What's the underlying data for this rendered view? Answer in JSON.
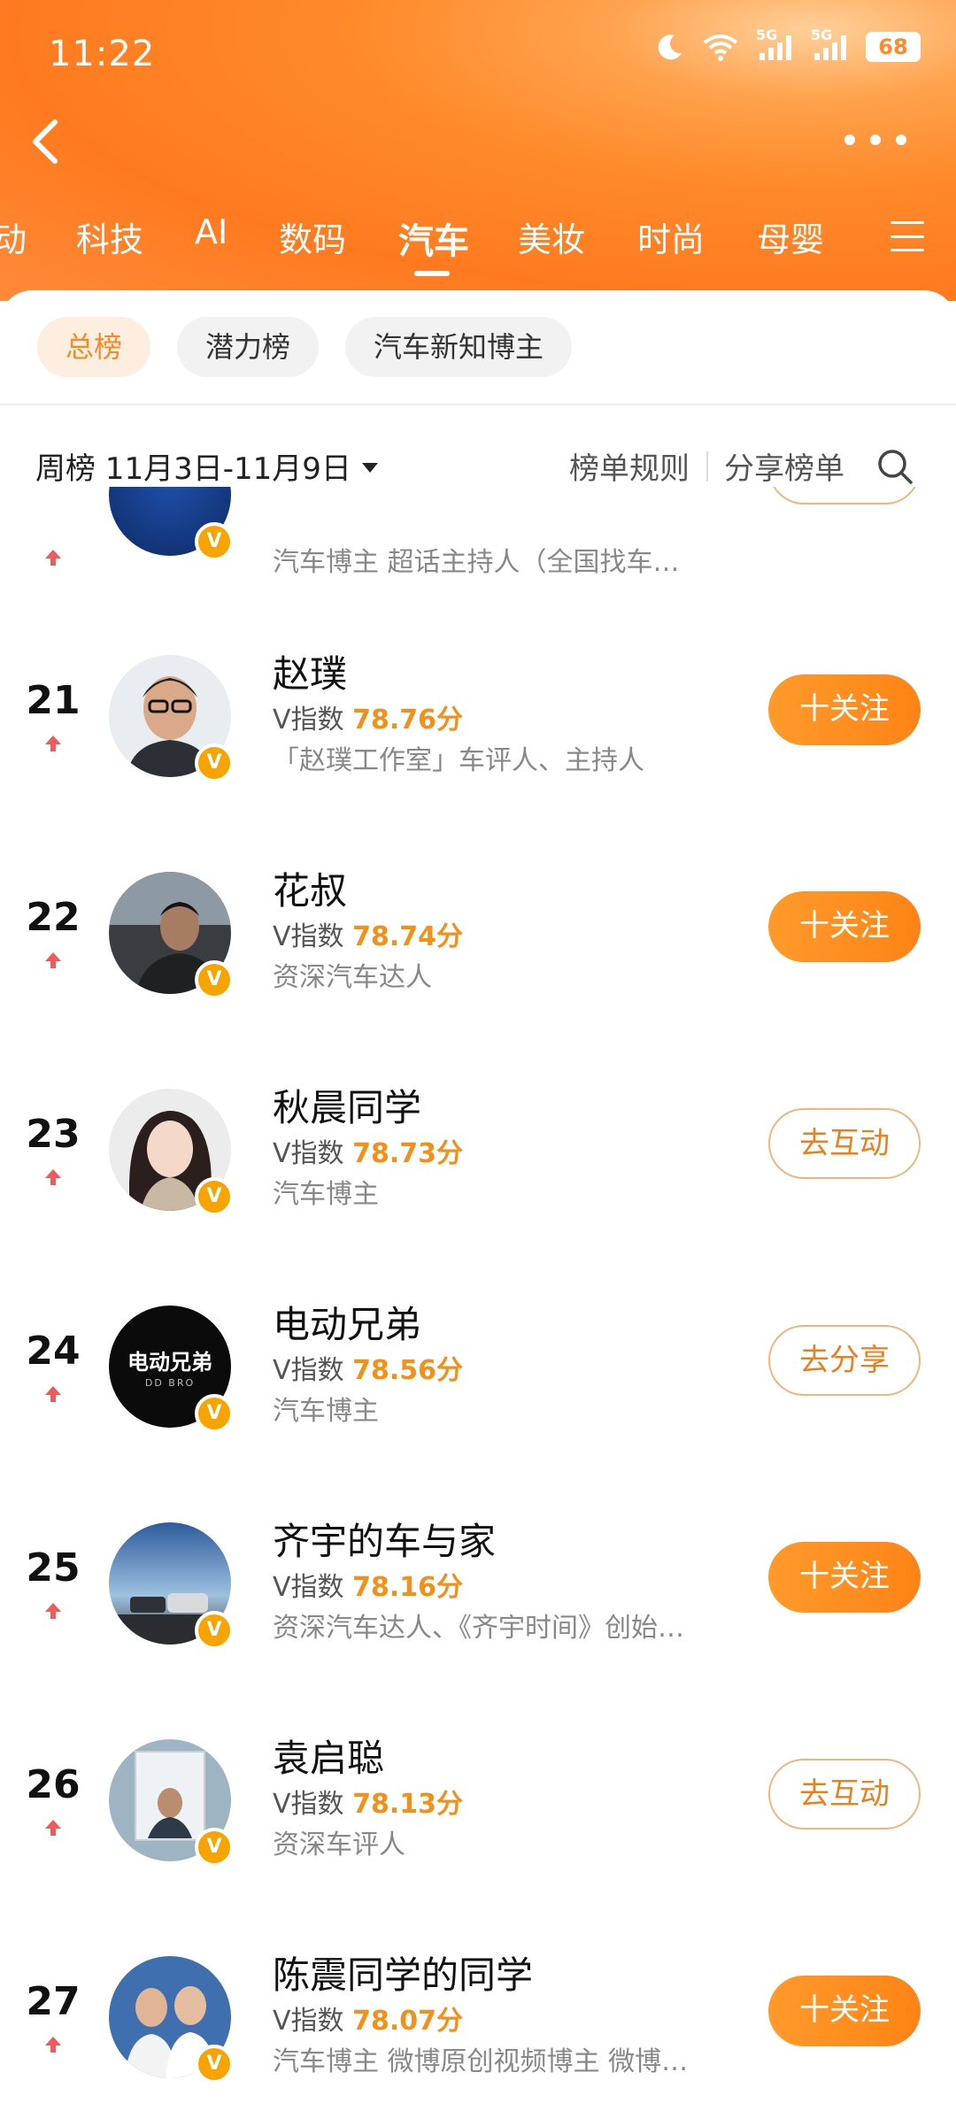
{
  "status": {
    "time": "11:22",
    "battery": "68",
    "signal_1": "5G",
    "signal_2": "5G"
  },
  "tabs": [
    "动",
    "科技",
    "AI",
    "数码",
    "汽车",
    "美妆",
    "时尚",
    "母婴"
  ],
  "active_tab": "汽车",
  "filters": [
    "总榜",
    "潜力榜",
    "汽车新知博主"
  ],
  "subbar": {
    "week": "周榜 11月3日-11月9日",
    "rules": "榜单规则",
    "share": "分享榜单"
  },
  "top_partial": {
    "desc": "汽车博主 超话主持人（全国找车…"
  },
  "rows": [
    {
      "rank": "21",
      "name": "赵璞",
      "index_label": "V指数",
      "score": "78.76分",
      "desc": "「赵璞工作室」车评人、主持人",
      "action": "十关注"
    },
    {
      "rank": "22",
      "name": "花叔",
      "index_label": "V指数",
      "score": "78.74分",
      "desc": "资深汽车达人",
      "action": "十关注"
    },
    {
      "rank": "23",
      "name": "秋晨同学",
      "index_label": "V指数",
      "score": "78.73分",
      "desc": "汽车博主",
      "action": "去互动"
    },
    {
      "rank": "24",
      "name": "电动兄弟",
      "index_label": "V指数",
      "score": "78.56分",
      "desc": "汽车博主",
      "action": "去分享",
      "avatar_text": "电动兄弟",
      "avatar_sub": "DD BRO"
    },
    {
      "rank": "25",
      "name": "齐宇的车与家",
      "index_label": "V指数",
      "score": "78.16分",
      "desc": "资深汽车达人、《齐宇时间》创始…",
      "action": "十关注"
    },
    {
      "rank": "26",
      "name": "袁启聪",
      "index_label": "V指数",
      "score": "78.13分",
      "desc": "资深车评人",
      "action": "去互动"
    },
    {
      "rank": "27",
      "name": "陈震同学的同学",
      "index_label": "V指数",
      "score": "78.07分",
      "desc": "汽车博主 微博原创视频博主 微博…",
      "action": "十关注"
    }
  ],
  "colors": {
    "accent": "#ff8a2a",
    "score": "#f39019",
    "chip_active_bg": "#fdeee0"
  },
  "badge": "V"
}
